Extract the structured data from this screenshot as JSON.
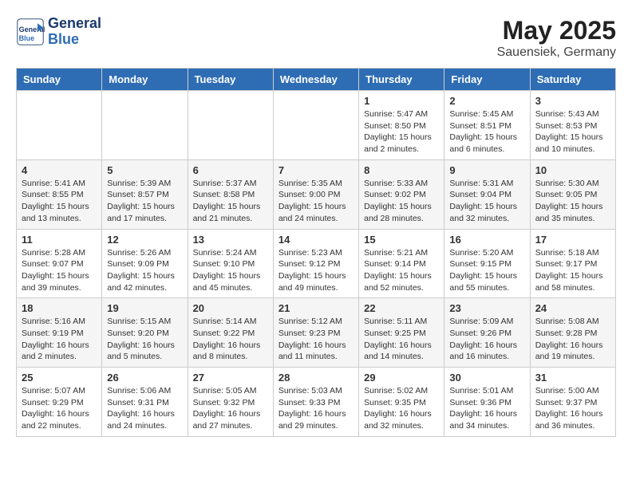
{
  "header": {
    "logo_line1": "General",
    "logo_line2": "Blue",
    "month_year": "May 2025",
    "location": "Sauensiek, Germany"
  },
  "weekdays": [
    "Sunday",
    "Monday",
    "Tuesday",
    "Wednesday",
    "Thursday",
    "Friday",
    "Saturday"
  ],
  "weeks": [
    [
      {
        "day": "",
        "info": ""
      },
      {
        "day": "",
        "info": ""
      },
      {
        "day": "",
        "info": ""
      },
      {
        "day": "",
        "info": ""
      },
      {
        "day": "1",
        "info": "Sunrise: 5:47 AM\nSunset: 8:50 PM\nDaylight: 15 hours\nand 2 minutes."
      },
      {
        "day": "2",
        "info": "Sunrise: 5:45 AM\nSunset: 8:51 PM\nDaylight: 15 hours\nand 6 minutes."
      },
      {
        "day": "3",
        "info": "Sunrise: 5:43 AM\nSunset: 8:53 PM\nDaylight: 15 hours\nand 10 minutes."
      }
    ],
    [
      {
        "day": "4",
        "info": "Sunrise: 5:41 AM\nSunset: 8:55 PM\nDaylight: 15 hours\nand 13 minutes."
      },
      {
        "day": "5",
        "info": "Sunrise: 5:39 AM\nSunset: 8:57 PM\nDaylight: 15 hours\nand 17 minutes."
      },
      {
        "day": "6",
        "info": "Sunrise: 5:37 AM\nSunset: 8:58 PM\nDaylight: 15 hours\nand 21 minutes."
      },
      {
        "day": "7",
        "info": "Sunrise: 5:35 AM\nSunset: 9:00 PM\nDaylight: 15 hours\nand 24 minutes."
      },
      {
        "day": "8",
        "info": "Sunrise: 5:33 AM\nSunset: 9:02 PM\nDaylight: 15 hours\nand 28 minutes."
      },
      {
        "day": "9",
        "info": "Sunrise: 5:31 AM\nSunset: 9:04 PM\nDaylight: 15 hours\nand 32 minutes."
      },
      {
        "day": "10",
        "info": "Sunrise: 5:30 AM\nSunset: 9:05 PM\nDaylight: 15 hours\nand 35 minutes."
      }
    ],
    [
      {
        "day": "11",
        "info": "Sunrise: 5:28 AM\nSunset: 9:07 PM\nDaylight: 15 hours\nand 39 minutes."
      },
      {
        "day": "12",
        "info": "Sunrise: 5:26 AM\nSunset: 9:09 PM\nDaylight: 15 hours\nand 42 minutes."
      },
      {
        "day": "13",
        "info": "Sunrise: 5:24 AM\nSunset: 9:10 PM\nDaylight: 15 hours\nand 45 minutes."
      },
      {
        "day": "14",
        "info": "Sunrise: 5:23 AM\nSunset: 9:12 PM\nDaylight: 15 hours\nand 49 minutes."
      },
      {
        "day": "15",
        "info": "Sunrise: 5:21 AM\nSunset: 9:14 PM\nDaylight: 15 hours\nand 52 minutes."
      },
      {
        "day": "16",
        "info": "Sunrise: 5:20 AM\nSunset: 9:15 PM\nDaylight: 15 hours\nand 55 minutes."
      },
      {
        "day": "17",
        "info": "Sunrise: 5:18 AM\nSunset: 9:17 PM\nDaylight: 15 hours\nand 58 minutes."
      }
    ],
    [
      {
        "day": "18",
        "info": "Sunrise: 5:16 AM\nSunset: 9:19 PM\nDaylight: 16 hours\nand 2 minutes."
      },
      {
        "day": "19",
        "info": "Sunrise: 5:15 AM\nSunset: 9:20 PM\nDaylight: 16 hours\nand 5 minutes."
      },
      {
        "day": "20",
        "info": "Sunrise: 5:14 AM\nSunset: 9:22 PM\nDaylight: 16 hours\nand 8 minutes."
      },
      {
        "day": "21",
        "info": "Sunrise: 5:12 AM\nSunset: 9:23 PM\nDaylight: 16 hours\nand 11 minutes."
      },
      {
        "day": "22",
        "info": "Sunrise: 5:11 AM\nSunset: 9:25 PM\nDaylight: 16 hours\nand 14 minutes."
      },
      {
        "day": "23",
        "info": "Sunrise: 5:09 AM\nSunset: 9:26 PM\nDaylight: 16 hours\nand 16 minutes."
      },
      {
        "day": "24",
        "info": "Sunrise: 5:08 AM\nSunset: 9:28 PM\nDaylight: 16 hours\nand 19 minutes."
      }
    ],
    [
      {
        "day": "25",
        "info": "Sunrise: 5:07 AM\nSunset: 9:29 PM\nDaylight: 16 hours\nand 22 minutes."
      },
      {
        "day": "26",
        "info": "Sunrise: 5:06 AM\nSunset: 9:31 PM\nDaylight: 16 hours\nand 24 minutes."
      },
      {
        "day": "27",
        "info": "Sunrise: 5:05 AM\nSunset: 9:32 PM\nDaylight: 16 hours\nand 27 minutes."
      },
      {
        "day": "28",
        "info": "Sunrise: 5:03 AM\nSunset: 9:33 PM\nDaylight: 16 hours\nand 29 minutes."
      },
      {
        "day": "29",
        "info": "Sunrise: 5:02 AM\nSunset: 9:35 PM\nDaylight: 16 hours\nand 32 minutes."
      },
      {
        "day": "30",
        "info": "Sunrise: 5:01 AM\nSunset: 9:36 PM\nDaylight: 16 hours\nand 34 minutes."
      },
      {
        "day": "31",
        "info": "Sunrise: 5:00 AM\nSunset: 9:37 PM\nDaylight: 16 hours\nand 36 minutes."
      }
    ]
  ]
}
